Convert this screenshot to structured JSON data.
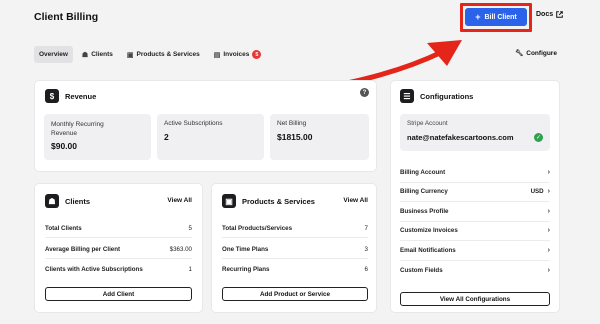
{
  "header": {
    "title": "Client Billing",
    "bill_client": "Bill Client",
    "docs": "Docs"
  },
  "tabs": [
    {
      "label": "Overview"
    },
    {
      "label": "Clients"
    },
    {
      "label": "Products & Services"
    },
    {
      "label": "Invoices",
      "badge": "5"
    }
  ],
  "configure": "Configure",
  "revenue": {
    "title": "Revenue",
    "stats": [
      {
        "label": "Monthly Recurring Revenue",
        "value": "$90.00"
      },
      {
        "label": "Active Subscriptions",
        "value": "2"
      },
      {
        "label": "Net Billing",
        "value": "$1815.00"
      }
    ]
  },
  "clients": {
    "title": "Clients",
    "view_all": "View All",
    "rows": [
      {
        "label": "Total Clients",
        "value": "5"
      },
      {
        "label": "Average Billing per Client",
        "value": "$363.00"
      },
      {
        "label": "Clients with Active Subscriptions",
        "value": "1"
      }
    ],
    "button": "Add Client"
  },
  "products": {
    "title": "Products & Services",
    "view_all": "View All",
    "rows": [
      {
        "label": "Total Products/Services",
        "value": "7"
      },
      {
        "label": "One Time Plans",
        "value": "3"
      },
      {
        "label": "Recurring Plans",
        "value": "6"
      }
    ],
    "button": "Add Product or Service"
  },
  "configurations": {
    "title": "Configurations",
    "stripe_label": "Stripe Account",
    "stripe_value": "nate@natefakescartoons.com",
    "rows": [
      {
        "label": "Billing Account",
        "value": ""
      },
      {
        "label": "Billing Currency",
        "value": "USD"
      },
      {
        "label": "Business Profile",
        "value": ""
      },
      {
        "label": "Customize Invoices",
        "value": ""
      },
      {
        "label": "Email Notifications",
        "value": ""
      },
      {
        "label": "Custom Fields",
        "value": ""
      }
    ],
    "button": "View All Configurations"
  },
  "colors": {
    "accent": "#2a63ea",
    "highlight": "#e3251a",
    "success": "#2ca24c"
  }
}
